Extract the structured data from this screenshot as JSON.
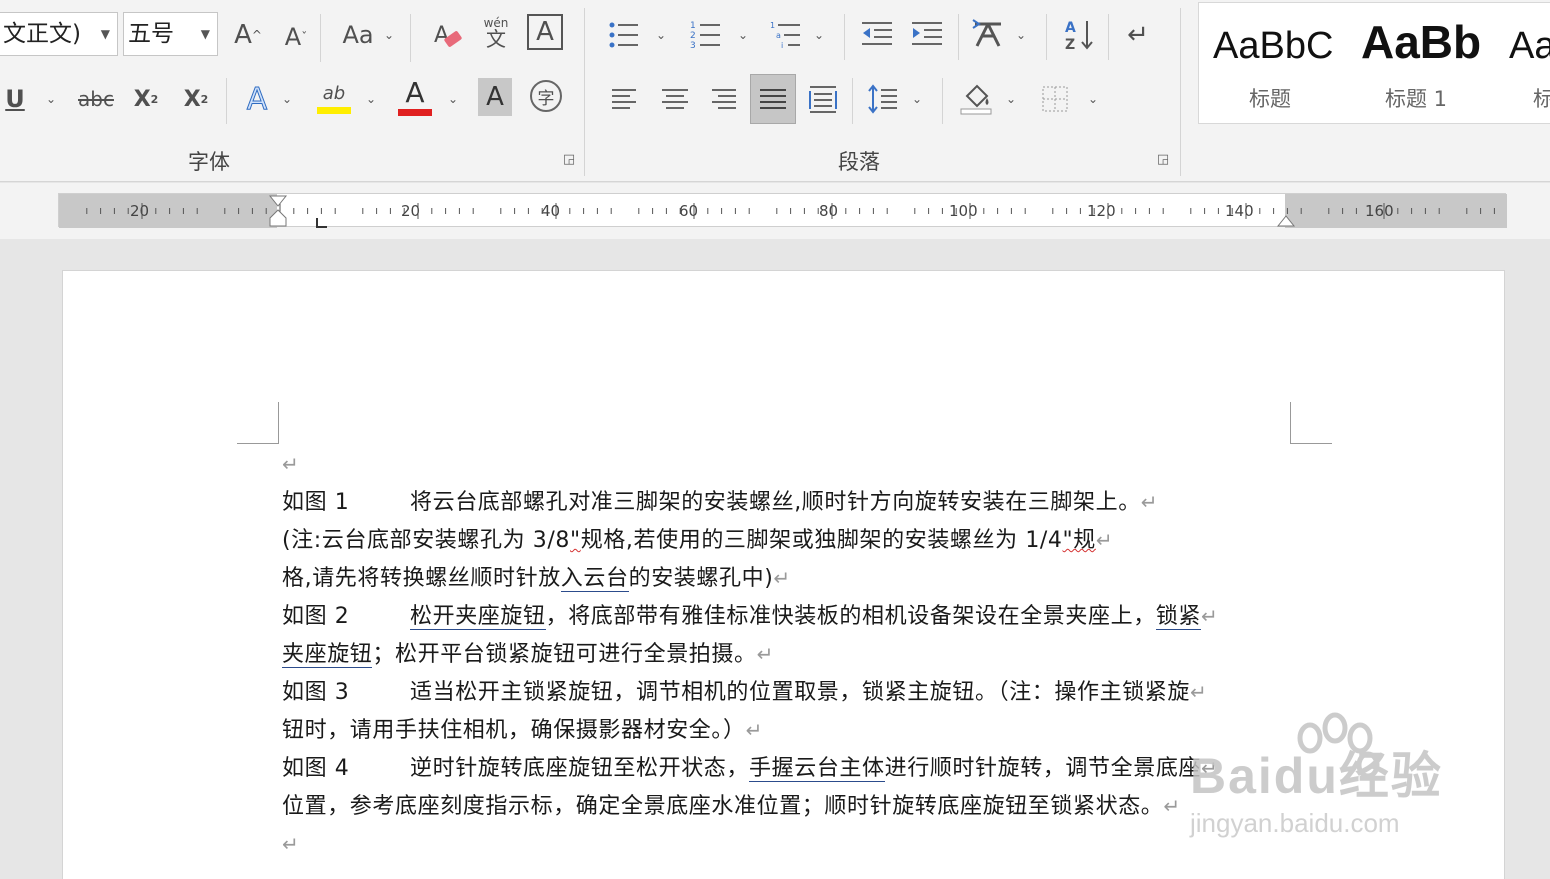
{
  "font": {
    "font_name": "文正文)",
    "font_size": "五号",
    "buttons": {
      "grow_font": "A",
      "shrink_font": "A",
      "change_case": "Aa",
      "pinyin": "wén",
      "pinyin_char": "文",
      "char_border": "A",
      "underline": "U",
      "strikethrough": "abc",
      "subscript": "X",
      "subscript_mark": "2",
      "superscript": "X",
      "superscript_mark": "2",
      "text_effect": "A",
      "highlight": "ab",
      "font_color": "A",
      "char_shading": "A",
      "enclose_char": "字"
    },
    "group_label": "字体",
    "colors": {
      "highlight": "#ffee00",
      "font_color": "#e02020"
    }
  },
  "paragraph": {
    "group_label": "段落",
    "sort_label": "A Z"
  },
  "styles": {
    "items": [
      {
        "preview": "AaBbC",
        "name": "标题"
      },
      {
        "preview": "AaBb",
        "name": "标题 1"
      },
      {
        "preview": "Aa",
        "name": "标"
      }
    ]
  },
  "ruler": {
    "labels": [
      "20",
      "20",
      "40",
      "60",
      "80",
      "100",
      "120",
      "140",
      "160"
    ]
  },
  "document": {
    "return_mark": "↵",
    "lines": [
      {
        "fig": "如图 1",
        "parts": [
          {
            "t": "将云台底部螺孔对准三脚架的安装螺丝,顺时针方向旋转安装在三脚架上。"
          }
        ]
      },
      {
        "fig": "",
        "parts": [
          {
            "t": "(注:云台底部安装螺孔为 3/8"
          },
          {
            "t": "\"",
            "s": true
          },
          {
            "t": "规格,若使用的三脚架或独脚架的安装螺丝为 1/4"
          },
          {
            "t": "\"规",
            "s": true
          }
        ]
      },
      {
        "fig": "",
        "parts": [
          {
            "t": "格,请先将转换螺丝顺时针放"
          },
          {
            "t": "入云台",
            "u": true
          },
          {
            "t": "的安装螺孔中)"
          }
        ]
      },
      {
        "fig": "如图 2",
        "parts": [
          {
            "t": "松开夹座旋钮",
            "u": true
          },
          {
            "t": "，将底部带有雅佳标准快装板的相机设备架设在全景夹座上，"
          },
          {
            "t": "锁紧",
            "u": true
          }
        ]
      },
      {
        "fig": "",
        "parts": [
          {
            "t": "夹座旋钮",
            "u": true
          },
          {
            "t": "；松开平台锁紧旋钮可进行全景拍摄。"
          }
        ]
      },
      {
        "fig": "如图 3",
        "parts": [
          {
            "t": "适当松开主锁紧旋钮，调节相机的位置取景，锁紧主旋钮。（注：操作主锁紧旋"
          }
        ]
      },
      {
        "fig": "",
        "parts": [
          {
            "t": "钮时，请用手扶住相机，确保摄影器材安全。）"
          }
        ]
      },
      {
        "fig": "如图 4",
        "parts": [
          {
            "t": "逆时针旋转底座旋钮至松开状态，"
          },
          {
            "t": "手握云台主体",
            "u": true
          },
          {
            "t": "进行顺时针旋转，调节全景底座"
          }
        ]
      },
      {
        "fig": "",
        "parts": [
          {
            "t": "位置，参考底座刻度指示标，确定全景底座水准位置；顺时针旋转底座旋钮至锁紧状态。"
          }
        ]
      }
    ]
  },
  "watermark": {
    "main": "Baidu经验",
    "url": "jingyan.baidu.com"
  }
}
